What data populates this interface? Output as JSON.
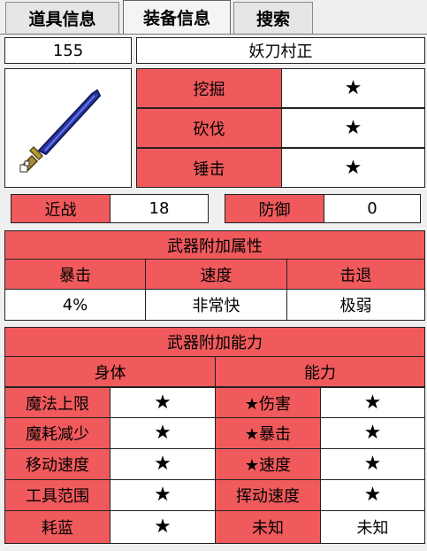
{
  "tabs": [
    {
      "label": "道具信息"
    },
    {
      "label": "装备信息"
    },
    {
      "label": "搜索"
    }
  ],
  "item": {
    "id": "155",
    "name": "妖刀村正",
    "tools": [
      {
        "label": "挖掘",
        "value": "★"
      },
      {
        "label": "砍伐",
        "value": "★"
      },
      {
        "label": "锤击",
        "value": "★"
      }
    ],
    "melee_label": "近战",
    "melee_value": "18",
    "defense_label": "防御",
    "defense_value": "0"
  },
  "attributes": {
    "title": "武器附加属性",
    "headers": [
      "暴击",
      "速度",
      "击退"
    ],
    "values": [
      "4%",
      "非常快",
      "极弱"
    ]
  },
  "abilities": {
    "title": "武器附加能力",
    "col_headers": [
      "身体",
      "能力"
    ],
    "rows": [
      {
        "left_label": "魔法上限",
        "left_value": "★",
        "right_label": "★伤害",
        "right_value": "★"
      },
      {
        "left_label": "魔耗减少",
        "left_value": "★",
        "right_label": "★暴击",
        "right_value": "★"
      },
      {
        "left_label": "移动速度",
        "left_value": "★",
        "right_label": "★速度",
        "right_value": "★"
      },
      {
        "left_label": "工具范围",
        "left_value": "★",
        "right_label": "挥动速度",
        "right_value": "★"
      },
      {
        "left_label": "耗蓝",
        "left_value": "★",
        "right_label": "未知",
        "right_value": "未知"
      }
    ]
  },
  "colors": {
    "accent_red": "#f05a5c",
    "cell_white": "#ffffff",
    "background": "#efefef"
  },
  "icons": {
    "item_icon": "muramasa-sword-icon"
  }
}
